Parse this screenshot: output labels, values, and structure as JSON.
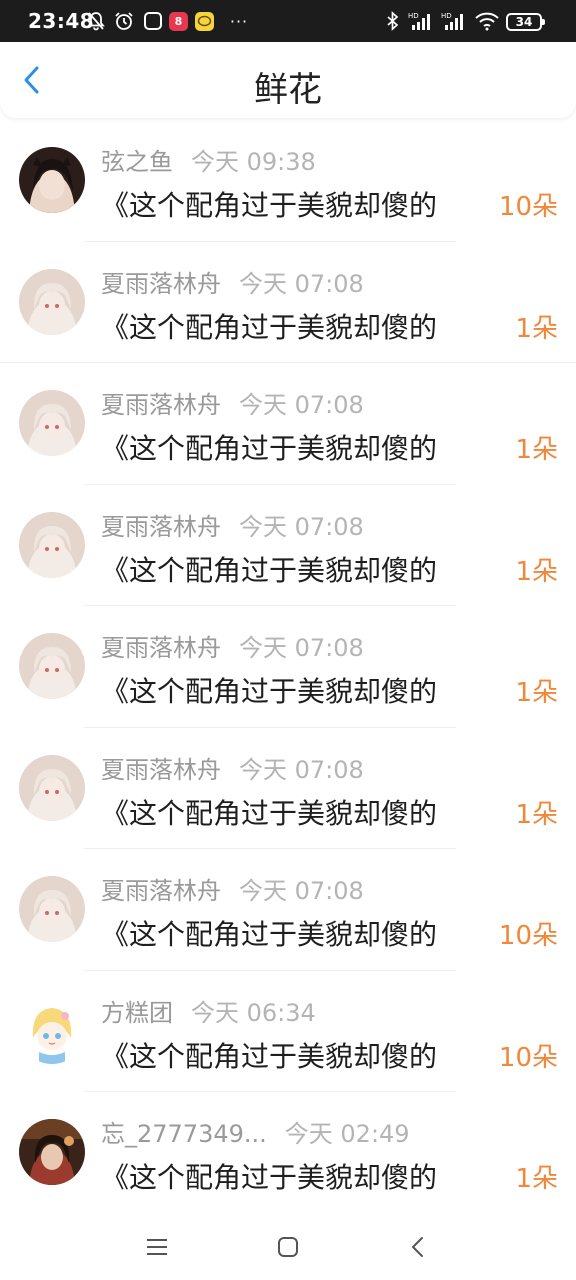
{
  "status_bar": {
    "time": "23:48",
    "app2_label": "8",
    "dots": "···",
    "battery": "34"
  },
  "header": {
    "title": "鲜花"
  },
  "items": [
    {
      "username": "弦之鱼",
      "time": "今天 09:38",
      "title": "《这个配角过于美貌却傻的",
      "count": "10朵",
      "avatar": "dark-hair-avatar"
    },
    {
      "username": "夏雨落林舟",
      "time": "今天 07:08",
      "title": "《这个配角过于美貌却傻的",
      "count": "1朵",
      "avatar": "white-hair-avatar"
    },
    {
      "username": "夏雨落林舟",
      "time": "今天 07:08",
      "title": "《这个配角过于美貌却傻的",
      "count": "1朵",
      "avatar": "white-hair-avatar"
    },
    {
      "username": "夏雨落林舟",
      "time": "今天 07:08",
      "title": "《这个配角过于美貌却傻的",
      "count": "1朵",
      "avatar": "white-hair-avatar"
    },
    {
      "username": "夏雨落林舟",
      "time": "今天 07:08",
      "title": "《这个配角过于美貌却傻的",
      "count": "1朵",
      "avatar": "white-hair-avatar"
    },
    {
      "username": "夏雨落林舟",
      "time": "今天 07:08",
      "title": "《这个配角过于美貌却傻的",
      "count": "1朵",
      "avatar": "white-hair-avatar"
    },
    {
      "username": "夏雨落林舟",
      "time": "今天 07:08",
      "title": "《这个配角过于美貌却傻的",
      "count": "10朵",
      "avatar": "white-hair-avatar"
    },
    {
      "username": "方糕团",
      "time": "今天 06:34",
      "title": "《这个配角过于美貌却傻的",
      "count": "10朵",
      "avatar": "blonde-chibi-avatar"
    },
    {
      "username": "忘_2777349...",
      "time": "今天 02:49",
      "title": "《这个配角过于美貌却傻的",
      "count": "1朵",
      "avatar": "brown-hair-avatar"
    }
  ],
  "colors": {
    "accent_blue": "#2b8fe8",
    "count_orange": "#f0873a",
    "meta_gray": "#9a9a9a"
  }
}
